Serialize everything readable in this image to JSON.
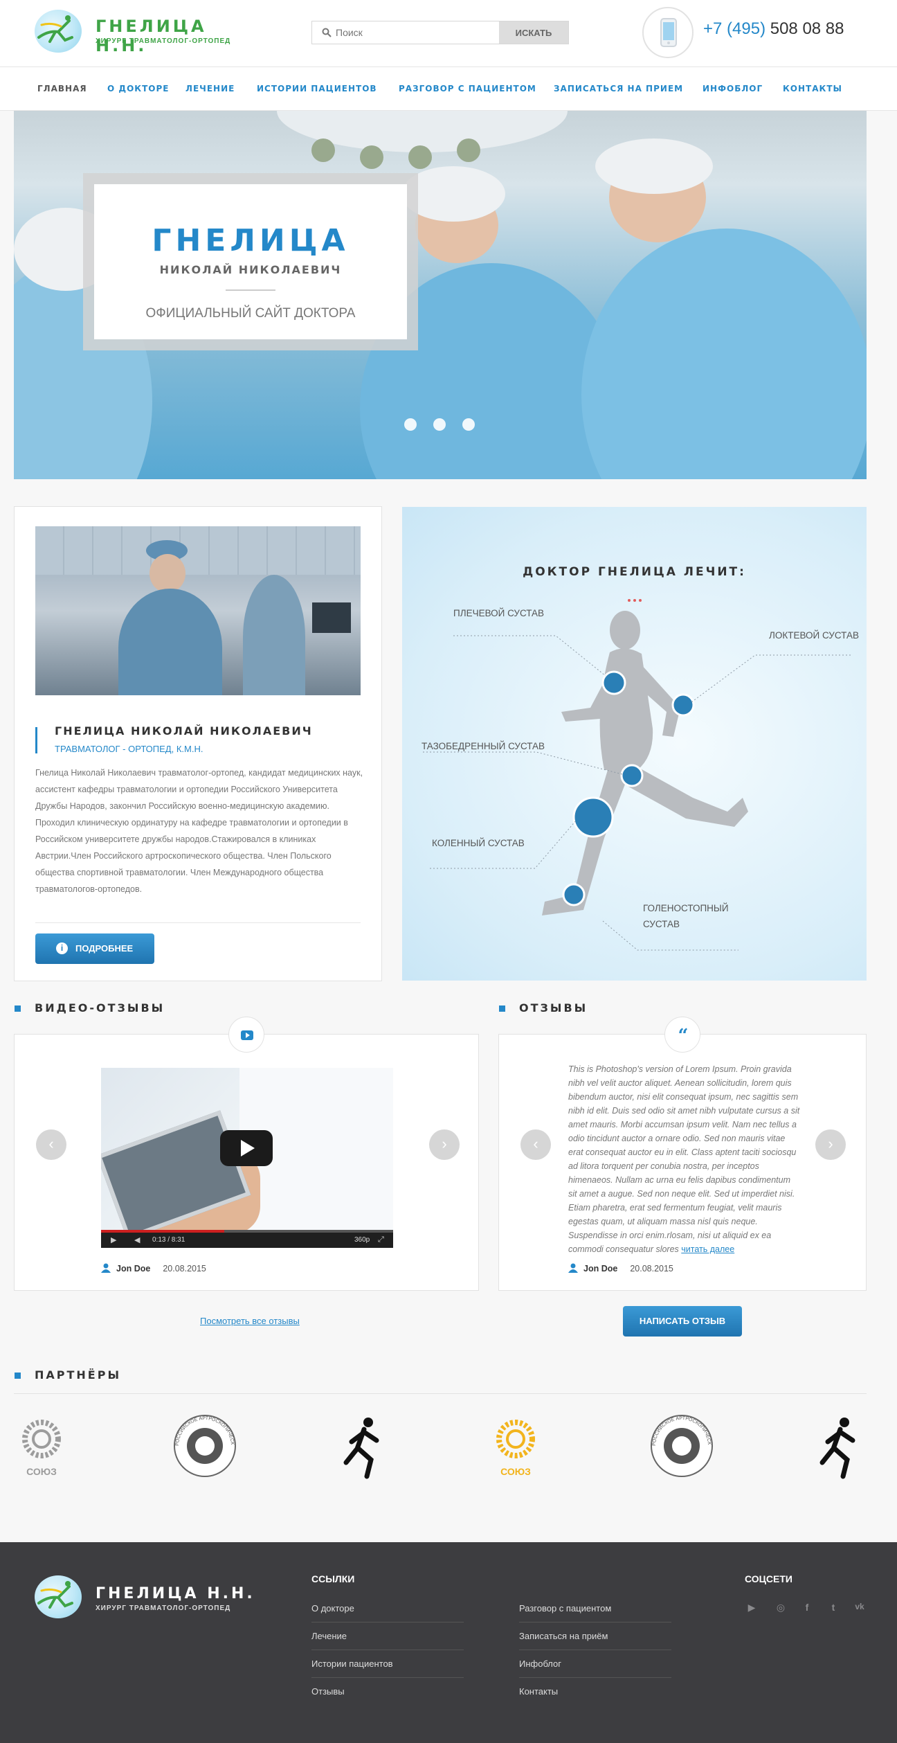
{
  "header": {
    "logo_title": "ГНЕЛИЦА Н.Н.",
    "logo_subtitle": "ХИРУРГ ТРАВМАТОЛОГ-ОРТОПЕД",
    "search_placeholder": "Поиск",
    "search_button": "ИСКАТЬ",
    "phone_code": "+7 (495)",
    "phone_number": "508 08 88"
  },
  "nav": {
    "items": [
      {
        "label": "ГЛАВНАЯ"
      },
      {
        "label": "О ДОКТОРЕ"
      },
      {
        "label": "ЛЕЧЕНИЕ"
      },
      {
        "label": "ИСТОРИИ ПАЦИЕНТОВ"
      },
      {
        "label": "РАЗГОВОР С ПАЦИЕНТОМ"
      },
      {
        "label": "ЗАПИСАТЬСЯ НА ПРИЕМ"
      },
      {
        "label": "ИНФОБЛОГ"
      },
      {
        "label": "КОНТАКТЫ"
      }
    ],
    "active": "ГЛАВНАЯ"
  },
  "hero": {
    "name": "ГНЕЛИЦА",
    "fullname": "НИКОЛАЙ НИКОЛАЕВИЧ",
    "tagline": "ОФИЦИАЛЬНЫЙ САЙТ ДОКТОРА"
  },
  "doctor": {
    "name": "ГНЕЛИЦА НИКОЛАЙ НИКОЛАЕВИЧ",
    "title": "ТРАВМАТОЛОГ - ОРТОПЕД, К.М.Н.",
    "bio": "Гнелица Николай Николаевич травматолог-ортопед, кандидат медицинских наук, ассистент кафедры травматологии и ортопедии Российского Университета Дружбы Народов, закончил Российскую военно-медицинскую академию. Проходил клиническую ординатуру на кафедре травматологии и ортопедии в Российском университете дружбы народов.Стажировался в клиниках Австрии.Член Российского артроскопического общества. Член Польского общества спортивной травматологии. Член Международного общества травматологов-ортопедов.",
    "more_button": "ПОДРОБНЕЕ"
  },
  "treats": {
    "title": "ДОКТОР ГНЕЛИЦА ЛЕЧИТ:",
    "shoulder": "ПЛЕЧЕВОЙ СУСТАВ",
    "elbow": "ЛОКТЕВОЙ СУСТАВ",
    "hip": "ТАЗОБЕДРЕННЫЙ СУСТАВ",
    "knee": "КОЛЕННЫЙ СУСТАВ",
    "ankle_1": "ГОЛЕНОСТОПНЫЙ",
    "ankle_2": "СУСТАВ"
  },
  "video_reviews": {
    "title": "ВИДЕО-ОТЗЫВЫ",
    "player_time": "0:13 / 8:31",
    "player_quality": "360p",
    "author": "Jon Doe",
    "date": "20.08.2015",
    "all_link": "Посмотреть все отзывы"
  },
  "reviews": {
    "title": "ОТЗЫВЫ",
    "text": "This is Photoshop's version  of Lorem Ipsum. Proin gravida nibh vel velit auctor aliquet. Aenean sollicitudin, lorem quis bibendum auctor, nisi elit consequat ipsum, nec sagittis sem nibh id elit. Duis sed odio sit amet nibh vulputate cursus a sit amet mauris. Morbi accumsan ipsum velit. Nam nec tellus a odio tincidunt auctor a ornare odio. Sed non  mauris vitae erat consequat auctor eu in elit. Class aptent taciti sociosqu ad litora torquent per conubia nostra, per inceptos himenaeos. Nullam ac urna eu felis dapibus condimentum sit amet a augue. Sed non neque elit. Sed ut imperdiet nisi. Etiam pharetra, erat sed fermentum feugiat, velit mauris egestas quam, ut aliquam massa nisl quis neque. Suspendisse in orci enim.rlosam, nisi ut aliquid ex ea commodi consequatur slores",
    "read_more": "читать далее",
    "author": "Jon Doe",
    "date": "20.08.2015",
    "write_button": "НАПИСАТЬ ОТЗЫВ"
  },
  "partners": {
    "title": "ПАРТНЁРЫ",
    "soyuz_label": "СОЮЗ",
    "arthro_label": "РОССИЙСКОЕ АРТРОСКОПИЧЕСКОЕ ОБЩЕСТВО"
  },
  "footer": {
    "logo_title": "ГНЕЛИЦА Н.Н.",
    "logo_subtitle": "ХИРУРГ ТРАВМАТОЛОГ-ОРТОПЕД",
    "links_title": "ССЫЛКИ",
    "links_col1": [
      "О докторе",
      "Лечение",
      "Истории пациентов",
      "Отзывы"
    ],
    "links_col2": [
      "Разговор с пациентом",
      "Записаться на приём",
      "Инфоблог",
      "Контакты"
    ],
    "social_title": "СОЦСЕТИ",
    "social_icons": [
      "youtube-icon",
      "instagram-icon",
      "facebook-icon",
      "twitter-icon",
      "vk-icon"
    ]
  },
  "colors": {
    "accent": "#2488c9",
    "brand_green": "#3fa447",
    "footer_bg": "#3d3d40"
  }
}
